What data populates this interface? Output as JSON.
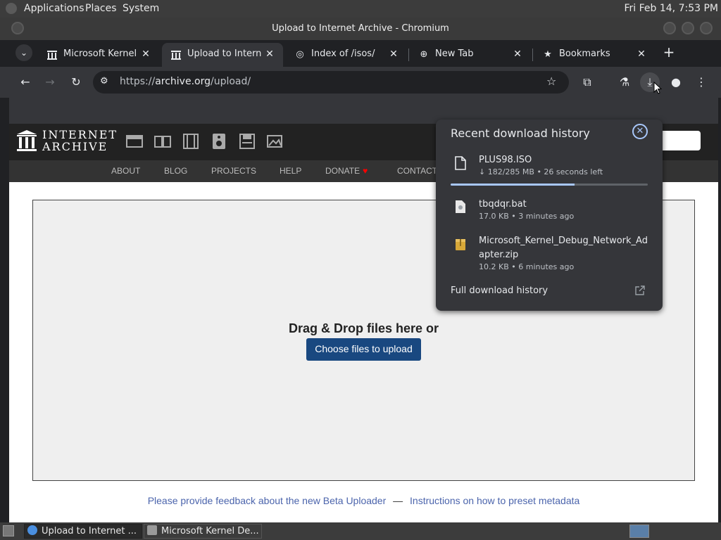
{
  "system_panel": {
    "menus": [
      "Applications",
      "Places",
      "System"
    ],
    "clock": "Fri Feb 14,  7:53 PM"
  },
  "window": {
    "title": "Upload to Internet Archive - Chromium"
  },
  "tabs": [
    {
      "title": "Microsoft Kernel D",
      "favicon": "archive-icon",
      "active": false
    },
    {
      "title": "Upload to Internet",
      "favicon": "archive-icon",
      "active": true
    },
    {
      "title": "Index of /isos/",
      "favicon": "globe-icon",
      "active": false
    },
    {
      "title": "New Tab",
      "favicon": "globe-icon",
      "active": false
    },
    {
      "title": "Bookmarks",
      "favicon": "star-icon",
      "active": false
    }
  ],
  "toolbar": {
    "url_scheme": "https://",
    "url_host": "archive.org",
    "url_path": "/upload/"
  },
  "ia": {
    "logo_line1": "INTERNET",
    "logo_line2": "ARCHIVE",
    "nav": [
      "ABOUT",
      "BLOG",
      "PROJECTS",
      "HELP",
      "DONATE",
      "CONTACT"
    ],
    "drop_text": "Drag & Drop files here or",
    "choose_button": "Choose files to upload",
    "feedback_link": "Please provide feedback about the new Beta Uploader",
    "feedback_sep": "—",
    "instructions_link": "Instructions on how to preset metadata"
  },
  "downloads": {
    "title": "Recent download history",
    "items": [
      {
        "name": "PLUS98.ISO",
        "meta": "↓ 182/285 MB • 26 seconds left",
        "icon": "file-icon",
        "progress": 0.63
      },
      {
        "name": "tbqdqr.bat",
        "meta": "17.0 KB • 3 minutes ago",
        "icon": "script-file-icon"
      },
      {
        "name": "Microsoft_Kernel_Debug_Network_Adapter.zip",
        "meta": "10.2 KB • 6 minutes ago",
        "icon": "zip-file-icon"
      }
    ],
    "full_history": "Full download history"
  },
  "taskbar": {
    "tasks": [
      "Upload to Internet ...",
      "Microsoft Kernel De..."
    ]
  },
  "colors": {
    "accent": "#a8c7fa",
    "ia_button": "#194880",
    "link": "#4b64ac"
  }
}
